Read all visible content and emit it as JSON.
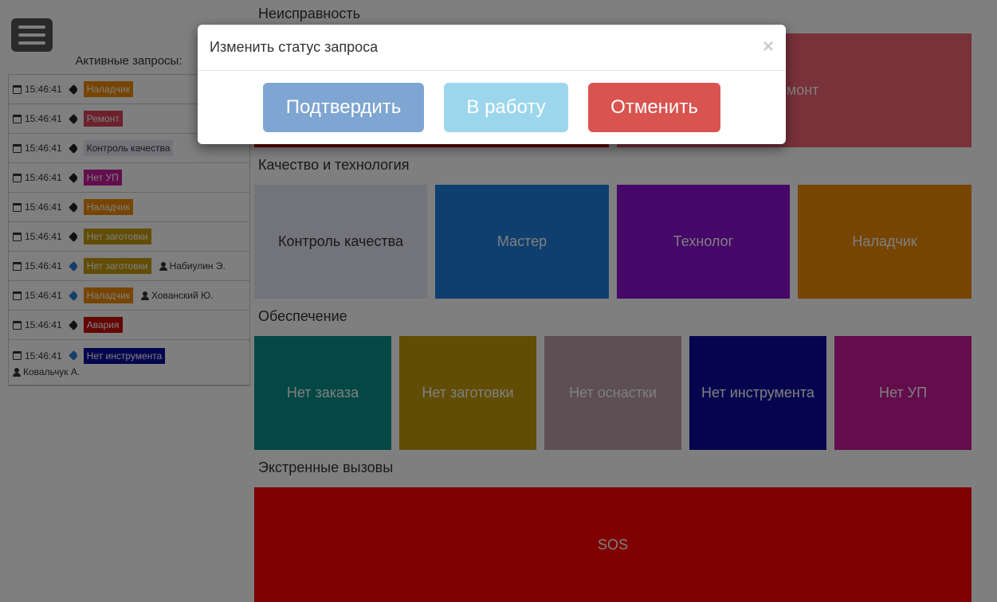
{
  "sidebar": {
    "active_title": "Активные запросы:",
    "requests": [
      {
        "time": "15:46:41",
        "label": "Наладчик",
        "color": "#ee8a05",
        "text_color": "#ffffff",
        "tag": "dark",
        "user": ""
      },
      {
        "time": "15:46:41",
        "label": "Ремонт",
        "color": "#d7455b",
        "text_color": "#ffffff",
        "tag": "dark",
        "user": ""
      },
      {
        "time": "15:46:41",
        "label": "Контроль качества",
        "color": "#e6e6f5",
        "text_color": "#333333",
        "tag": "dark",
        "user": ""
      },
      {
        "time": "15:46:41",
        "label": "Нет УП",
        "color": "#c61a9a",
        "text_color": "#ffffff",
        "tag": "dark",
        "user": ""
      },
      {
        "time": "15:46:41",
        "label": "Наладчик",
        "color": "#ee8a05",
        "text_color": "#ffffff",
        "tag": "dark",
        "user": ""
      },
      {
        "time": "15:46:41",
        "label": "Нет заготовки",
        "color": "#c49a0a",
        "text_color": "#ffffff",
        "tag": "dark",
        "user": ""
      },
      {
        "time": "15:46:41",
        "label": "Нет заготовки",
        "color": "#c49a0a",
        "text_color": "#ffffff",
        "tag": "blue",
        "user": "Набиулин Э."
      },
      {
        "time": "15:46:41",
        "label": "Наладчик",
        "color": "#ee8a05",
        "text_color": "#ffffff",
        "tag": "blue",
        "user": "Хованский Ю."
      },
      {
        "time": "15:46:41",
        "label": "Авария",
        "color": "#c80d0d",
        "text_color": "#ffffff",
        "tag": "dark",
        "user": ""
      },
      {
        "time": "15:46:41",
        "label": "Нет инструмента",
        "color": "#0a0a9e",
        "text_color": "#ffffff",
        "tag": "blue",
        "user": "Ковальчук А."
      }
    ]
  },
  "sections": {
    "malfunction": "Неисправность",
    "quality": "Качество и технология",
    "supply": "Обеспечение",
    "emergency": "Экстренные вызовы"
  },
  "tiles": {
    "malfunction_left": {
      "label": "",
      "color": "#c80d0d"
    },
    "repair": {
      "label": "Ремонт",
      "color": "#f26375"
    },
    "quality_control": {
      "label": "Контроль качества",
      "color": "#e6e6f5",
      "text_color": "#333333"
    },
    "master": {
      "label": "Мастер",
      "color": "#1f7fdc"
    },
    "technologist": {
      "label": "Технолог",
      "color": "#8a0ed1"
    },
    "adjuster": {
      "label": "Наладчик",
      "color": "#ee8a05"
    },
    "no_order": {
      "label": "Нет заказа",
      "color": "#09908a"
    },
    "no_blank": {
      "label": "Нет заготовки",
      "color": "#c49a0a"
    },
    "no_tooling": {
      "label": "Нет оснастки",
      "color": "#bb9ea6"
    },
    "no_tool": {
      "label": "Нет инструмента",
      "color": "#0a0a9e"
    },
    "no_program": {
      "label": "Нет УП",
      "color": "#c61a9a"
    },
    "sos": {
      "label": "SOS",
      "color": "#ff0000"
    }
  },
  "modal": {
    "title": "Изменить статус запроса",
    "close": "×",
    "confirm_label": "Подтвердить",
    "confirm_color": "#7fa6d2",
    "in_work_label": "В работу",
    "in_work_color": "#9cd6ec",
    "cancel_label": "Отменить",
    "cancel_color": "#d9534f"
  }
}
